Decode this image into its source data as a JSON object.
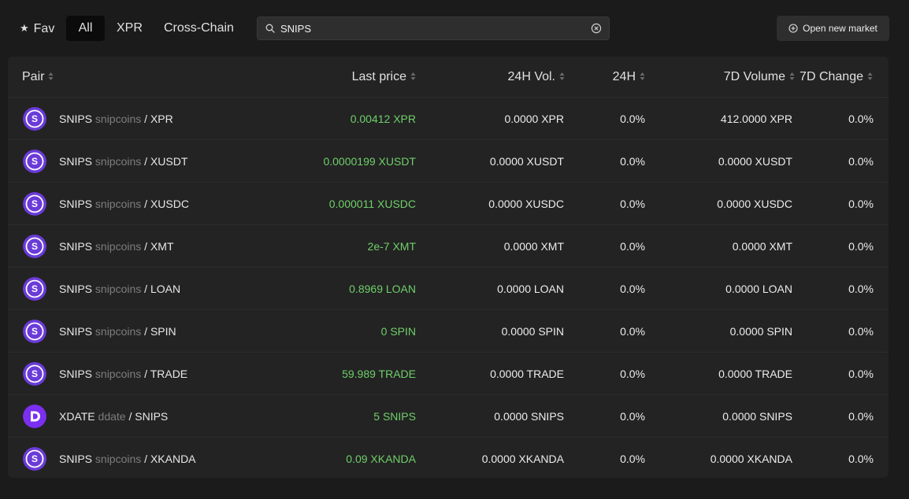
{
  "colors": {
    "background": "#1b1b1b",
    "panel": "#232323",
    "positive_price": "#6fcf6a",
    "coin_snips": "#6a3bd8",
    "coin_ddate": "#7b2ff0"
  },
  "tabs": {
    "fav": "Fav",
    "all": "All",
    "xpr": "XPR",
    "cross_chain": "Cross-Chain",
    "active": "All"
  },
  "search": {
    "value": "SNIPS",
    "icon": "search-icon",
    "clear_icon": "clear-circle-icon"
  },
  "open_market": {
    "label": "Open new market",
    "icon": "plus-circle-icon"
  },
  "table": {
    "headers": {
      "pair": "Pair",
      "last_price": "Last price",
      "vol_24h": "24H Vol.",
      "change_24h": "24H",
      "volume_7d": "7D Volume",
      "change_7d": "7D Change"
    },
    "rows": [
      {
        "icon": "snips-coin-icon",
        "symbol": "SNIPS",
        "name": "snipcoins",
        "quote": "/ XPR",
        "last": "0.00412 XPR",
        "vol": "0.0000 XPR",
        "ch24": "0.0%",
        "vol7": "412.0000 XPR",
        "ch7": "0.0%"
      },
      {
        "icon": "snips-coin-icon",
        "symbol": "SNIPS",
        "name": "snipcoins",
        "quote": "/ XUSDT",
        "last": "0.0000199 XUSDT",
        "vol": "0.0000 XUSDT",
        "ch24": "0.0%",
        "vol7": "0.0000 XUSDT",
        "ch7": "0.0%"
      },
      {
        "icon": "snips-coin-icon",
        "symbol": "SNIPS",
        "name": "snipcoins",
        "quote": "/ XUSDC",
        "last": "0.000011 XUSDC",
        "vol": "0.0000 XUSDC",
        "ch24": "0.0%",
        "vol7": "0.0000 XUSDC",
        "ch7": "0.0%"
      },
      {
        "icon": "snips-coin-icon",
        "symbol": "SNIPS",
        "name": "snipcoins",
        "quote": "/ XMT",
        "last": "2e-7 XMT",
        "vol": "0.0000 XMT",
        "ch24": "0.0%",
        "vol7": "0.0000 XMT",
        "ch7": "0.0%"
      },
      {
        "icon": "snips-coin-icon",
        "symbol": "SNIPS",
        "name": "snipcoins",
        "quote": "/ LOAN",
        "last": "0.8969 LOAN",
        "vol": "0.0000 LOAN",
        "ch24": "0.0%",
        "vol7": "0.0000 LOAN",
        "ch7": "0.0%"
      },
      {
        "icon": "snips-coin-icon",
        "symbol": "SNIPS",
        "name": "snipcoins",
        "quote": "/ SPIN",
        "last": "0 SPIN",
        "vol": "0.0000 SPIN",
        "ch24": "0.0%",
        "vol7": "0.0000 SPIN",
        "ch7": "0.0%"
      },
      {
        "icon": "snips-coin-icon",
        "symbol": "SNIPS",
        "name": "snipcoins",
        "quote": "/ TRADE",
        "last": "59.989 TRADE",
        "vol": "0.0000 TRADE",
        "ch24": "0.0%",
        "vol7": "0.0000 TRADE",
        "ch7": "0.0%"
      },
      {
        "icon": "ddate-coin-icon",
        "symbol": "XDATE",
        "name": "ddate",
        "quote": "/ SNIPS",
        "last": "5 SNIPS",
        "vol": "0.0000 SNIPS",
        "ch24": "0.0%",
        "vol7": "0.0000 SNIPS",
        "ch7": "0.0%"
      },
      {
        "icon": "snips-coin-icon",
        "symbol": "SNIPS",
        "name": "snipcoins",
        "quote": "/ XKANDA",
        "last": "0.09 XKANDA",
        "vol": "0.0000 XKANDA",
        "ch24": "0.0%",
        "vol7": "0.0000 XKANDA",
        "ch7": "0.0%"
      }
    ]
  }
}
